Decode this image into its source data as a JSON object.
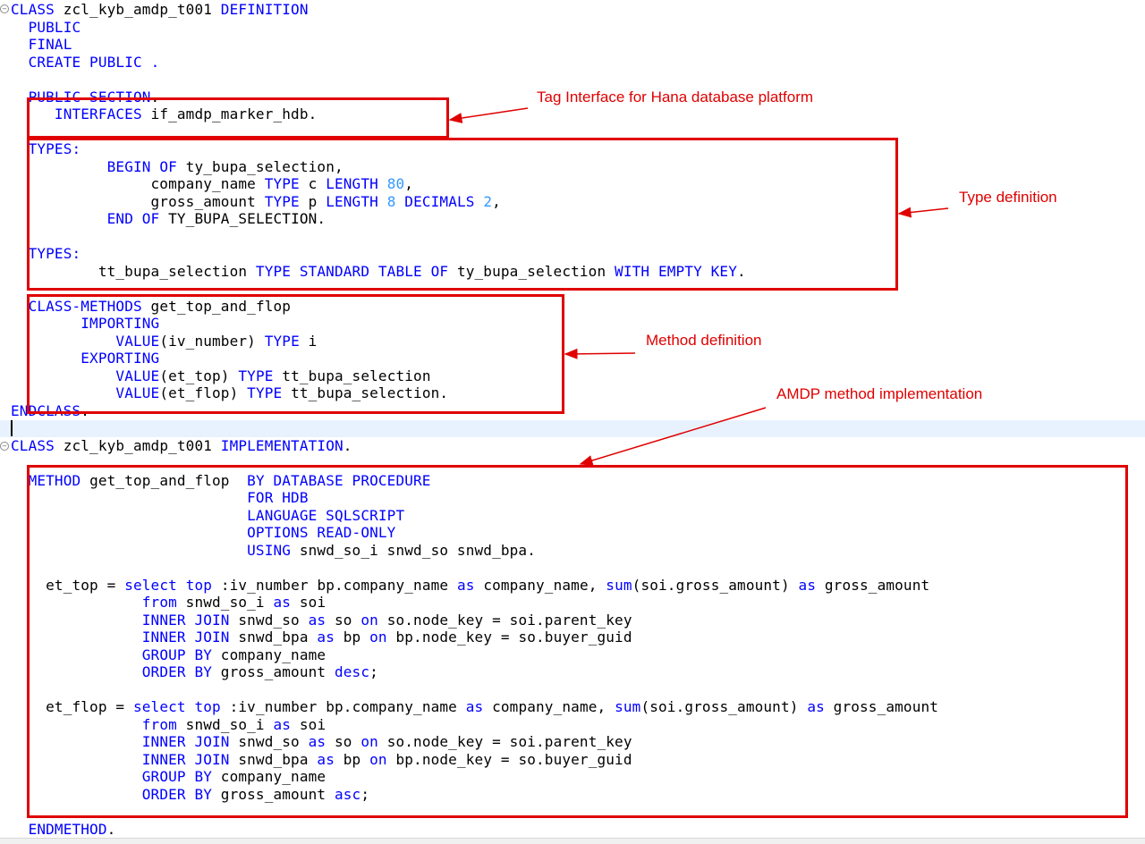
{
  "code_lines": [
    [
      {
        "t": "CLASS",
        "k": "kw"
      },
      {
        "t": " zcl_kyb_amdp_t001 "
      },
      {
        "t": "DEFINITION",
        "k": "kw"
      }
    ],
    [
      {
        "t": "  "
      },
      {
        "t": "PUBLIC",
        "k": "kw"
      }
    ],
    [
      {
        "t": "  "
      },
      {
        "t": "FINAL",
        "k": "kw"
      }
    ],
    [
      {
        "t": "  "
      },
      {
        "t": "CREATE PUBLIC",
        "k": "kw"
      },
      {
        "t": " "
      },
      {
        "t": ".",
        "k": "kw"
      }
    ],
    [
      {
        "t": ""
      }
    ],
    [
      {
        "t": "  "
      },
      {
        "t": "PUBLIC SECTION",
        "k": "kw"
      },
      {
        "t": "."
      }
    ],
    [
      {
        "t": "     "
      },
      {
        "t": "INTERFACES",
        "k": "kw"
      },
      {
        "t": " if_amdp_marker_hdb."
      }
    ],
    [
      {
        "t": ""
      }
    ],
    [
      {
        "t": "  "
      },
      {
        "t": "TYPES:",
        "k": "kw"
      }
    ],
    [
      {
        "t": "           "
      },
      {
        "t": "BEGIN OF",
        "k": "kw"
      },
      {
        "t": " ty_bupa_selection,"
      }
    ],
    [
      {
        "t": "                company_name "
      },
      {
        "t": "TYPE",
        "k": "kw"
      },
      {
        "t": " c "
      },
      {
        "t": "LENGTH",
        "k": "kw"
      },
      {
        "t": " "
      },
      {
        "t": "80",
        "k": "num"
      },
      {
        "t": ","
      }
    ],
    [
      {
        "t": "                gross_amount "
      },
      {
        "t": "TYPE",
        "k": "kw"
      },
      {
        "t": " p "
      },
      {
        "t": "LENGTH",
        "k": "kw"
      },
      {
        "t": " "
      },
      {
        "t": "8",
        "k": "num"
      },
      {
        "t": " "
      },
      {
        "t": "DECIMALS",
        "k": "kw"
      },
      {
        "t": " "
      },
      {
        "t": "2",
        "k": "num"
      },
      {
        "t": ","
      }
    ],
    [
      {
        "t": "           "
      },
      {
        "t": "END OF",
        "k": "kw"
      },
      {
        "t": " TY_BUPA_SELECTION."
      }
    ],
    [
      {
        "t": ""
      }
    ],
    [
      {
        "t": "  "
      },
      {
        "t": "TYPES:",
        "k": "kw"
      }
    ],
    [
      {
        "t": "          tt_bupa_selection "
      },
      {
        "t": "TYPE STANDARD TABLE OF",
        "k": "kw"
      },
      {
        "t": " ty_bupa_selection "
      },
      {
        "t": "WITH EMPTY KEY",
        "k": "kw"
      },
      {
        "t": "."
      }
    ],
    [
      {
        "t": ""
      }
    ],
    [
      {
        "t": "  "
      },
      {
        "t": "CLASS-METHODS",
        "k": "kw"
      },
      {
        "t": " get_top_and_flop"
      }
    ],
    [
      {
        "t": "        "
      },
      {
        "t": "IMPORTING",
        "k": "kw"
      }
    ],
    [
      {
        "t": "            "
      },
      {
        "t": "VALUE",
        "k": "kw"
      },
      {
        "t": "(iv_number) "
      },
      {
        "t": "TYPE",
        "k": "kw"
      },
      {
        "t": " i"
      }
    ],
    [
      {
        "t": "        "
      },
      {
        "t": "EXPORTING",
        "k": "kw"
      }
    ],
    [
      {
        "t": "            "
      },
      {
        "t": "VALUE",
        "k": "kw"
      },
      {
        "t": "(et_top) "
      },
      {
        "t": "TYPE",
        "k": "kw"
      },
      {
        "t": " tt_bupa_selection"
      }
    ],
    [
      {
        "t": "            "
      },
      {
        "t": "VALUE",
        "k": "kw"
      },
      {
        "t": "(et_flop) "
      },
      {
        "t": "TYPE",
        "k": "kw"
      },
      {
        "t": " tt_bupa_selection."
      }
    ],
    [
      {
        "t": "ENDCLASS",
        "k": "kw"
      },
      {
        "t": "."
      }
    ],
    [
      {
        "t": ""
      }
    ],
    [
      {
        "t": "CLASS",
        "k": "kw"
      },
      {
        "t": " zcl_kyb_amdp_t001 "
      },
      {
        "t": "IMPLEMENTATION",
        "k": "kw"
      },
      {
        "t": "."
      }
    ],
    [
      {
        "t": ""
      }
    ],
    [
      {
        "t": "  "
      },
      {
        "t": "METHOD",
        "k": "kw"
      },
      {
        "t": " get_top_and_flop  "
      },
      {
        "t": "BY DATABASE PROCEDURE",
        "k": "kw"
      }
    ],
    [
      {
        "t": "                           "
      },
      {
        "t": "FOR HDB",
        "k": "kw"
      }
    ],
    [
      {
        "t": "                           "
      },
      {
        "t": "LANGUAGE SQLSCRIPT",
        "k": "kw"
      }
    ],
    [
      {
        "t": "                           "
      },
      {
        "t": "OPTIONS READ-ONLY",
        "k": "kw"
      }
    ],
    [
      {
        "t": "                           "
      },
      {
        "t": "USING",
        "k": "kw"
      },
      {
        "t": " snwd_so_i snwd_so snwd_bpa."
      }
    ],
    [
      {
        "t": ""
      }
    ],
    [
      {
        "t": "    et_top = "
      },
      {
        "t": "select",
        "k": "kw"
      },
      {
        "t": " "
      },
      {
        "t": "top",
        "k": "kw"
      },
      {
        "t": " :iv_number bp.company_name "
      },
      {
        "t": "as",
        "k": "kw"
      },
      {
        "t": " company_name, "
      },
      {
        "t": "sum",
        "k": "kw"
      },
      {
        "t": "(soi.gross_amount) "
      },
      {
        "t": "as",
        "k": "kw"
      },
      {
        "t": " gross_amount"
      }
    ],
    [
      {
        "t": "               "
      },
      {
        "t": "from",
        "k": "kw"
      },
      {
        "t": " snwd_so_i "
      },
      {
        "t": "as",
        "k": "kw"
      },
      {
        "t": " soi"
      }
    ],
    [
      {
        "t": "               "
      },
      {
        "t": "INNER JOIN",
        "k": "kw"
      },
      {
        "t": " snwd_so "
      },
      {
        "t": "as",
        "k": "kw"
      },
      {
        "t": " so "
      },
      {
        "t": "on",
        "k": "kw"
      },
      {
        "t": " so.node_key = soi.parent_key"
      }
    ],
    [
      {
        "t": "               "
      },
      {
        "t": "INNER JOIN",
        "k": "kw"
      },
      {
        "t": " snwd_bpa "
      },
      {
        "t": "as",
        "k": "kw"
      },
      {
        "t": " bp "
      },
      {
        "t": "on",
        "k": "kw"
      },
      {
        "t": " bp.node_key = so.buyer_guid"
      }
    ],
    [
      {
        "t": "               "
      },
      {
        "t": "GROUP BY",
        "k": "kw"
      },
      {
        "t": " company_name"
      }
    ],
    [
      {
        "t": "               "
      },
      {
        "t": "ORDER BY",
        "k": "kw"
      },
      {
        "t": " gross_amount "
      },
      {
        "t": "desc",
        "k": "kw"
      },
      {
        "t": ";"
      }
    ],
    [
      {
        "t": ""
      }
    ],
    [
      {
        "t": "    et_flop = "
      },
      {
        "t": "select",
        "k": "kw"
      },
      {
        "t": " "
      },
      {
        "t": "top",
        "k": "kw"
      },
      {
        "t": " :iv_number bp.company_name "
      },
      {
        "t": "as",
        "k": "kw"
      },
      {
        "t": " company_name, "
      },
      {
        "t": "sum",
        "k": "kw"
      },
      {
        "t": "(soi.gross_amount) "
      },
      {
        "t": "as",
        "k": "kw"
      },
      {
        "t": " gross_amount"
      }
    ],
    [
      {
        "t": "               "
      },
      {
        "t": "from",
        "k": "kw"
      },
      {
        "t": " snwd_so_i "
      },
      {
        "t": "as",
        "k": "kw"
      },
      {
        "t": " soi"
      }
    ],
    [
      {
        "t": "               "
      },
      {
        "t": "INNER JOIN",
        "k": "kw"
      },
      {
        "t": " snwd_so "
      },
      {
        "t": "as",
        "k": "kw"
      },
      {
        "t": " so "
      },
      {
        "t": "on",
        "k": "kw"
      },
      {
        "t": " so.node_key = soi.parent_key"
      }
    ],
    [
      {
        "t": "               "
      },
      {
        "t": "INNER JOIN",
        "k": "kw"
      },
      {
        "t": " snwd_bpa "
      },
      {
        "t": "as",
        "k": "kw"
      },
      {
        "t": " bp "
      },
      {
        "t": "on",
        "k": "kw"
      },
      {
        "t": " bp.node_key = so.buyer_guid"
      }
    ],
    [
      {
        "t": "               "
      },
      {
        "t": "GROUP BY",
        "k": "kw"
      },
      {
        "t": " company_name"
      }
    ],
    [
      {
        "t": "               "
      },
      {
        "t": "ORDER BY",
        "k": "kw"
      },
      {
        "t": " gross_amount "
      },
      {
        "t": "asc",
        "k": "kw"
      },
      {
        "t": ";"
      }
    ],
    [
      {
        "t": ""
      }
    ],
    [
      {
        "t": "  "
      },
      {
        "t": "ENDMETHOD",
        "k": "kw"
      },
      {
        "t": "."
      }
    ]
  ],
  "annotations": {
    "tag_interface": "Tag Interface for Hana database platform",
    "type_definition": "Type definition",
    "method_definition": "Method definition",
    "amdp_implementation": "AMDP method implementation"
  },
  "colors": {
    "keyword": "#0000ff",
    "number": "#3399ff",
    "annotation": "#e00000",
    "current_line": "#e8f2fe"
  },
  "fold_marker_symbol": "−"
}
